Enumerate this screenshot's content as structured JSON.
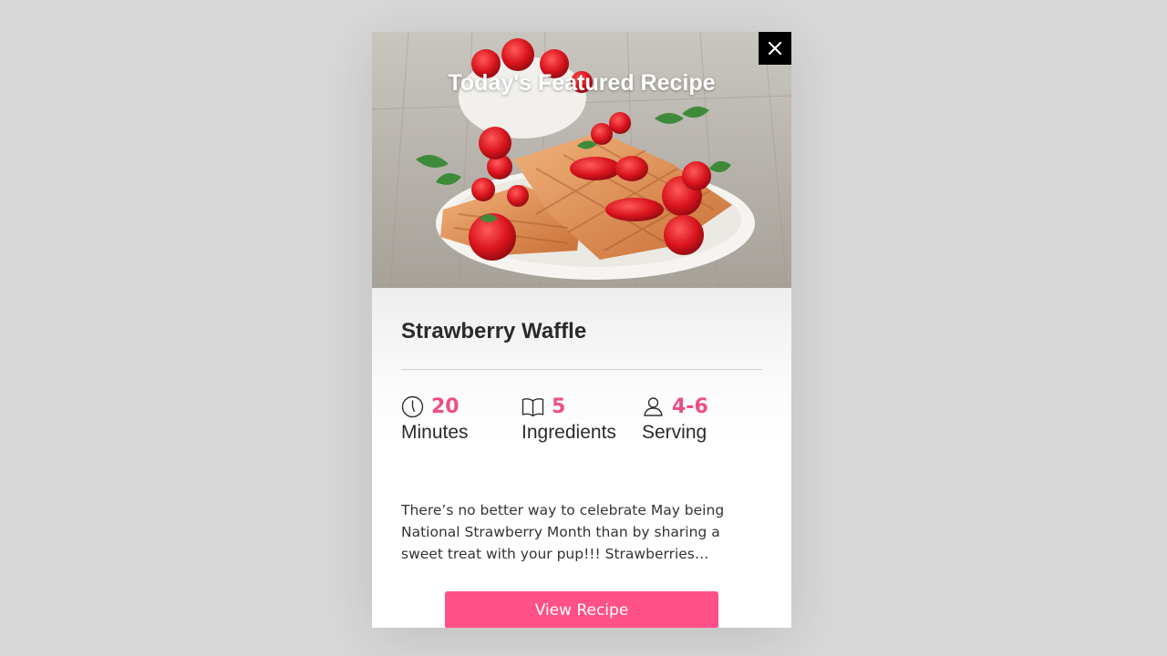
{
  "modal": {
    "heading": "Today's Featured Recipe"
  },
  "recipe": {
    "name": "Strawberry Waffle",
    "stats": [
      {
        "icon": "clock-icon",
        "value": "20",
        "label": "Minutes"
      },
      {
        "icon": "book-icon",
        "value": "5",
        "label": "Ingredients"
      },
      {
        "icon": "person-icon",
        "value": "4-6",
        "label": "Serving"
      }
    ],
    "description": "There’s no better way to celebrate May being National Strawberry Month than by sharing a sweet treat with your pup!!! Strawberries…",
    "cta_label": "View Recipe"
  },
  "colors": {
    "accent": "#ff5188",
    "stat_value": "#ee4d86",
    "close_bg": "#000000"
  }
}
